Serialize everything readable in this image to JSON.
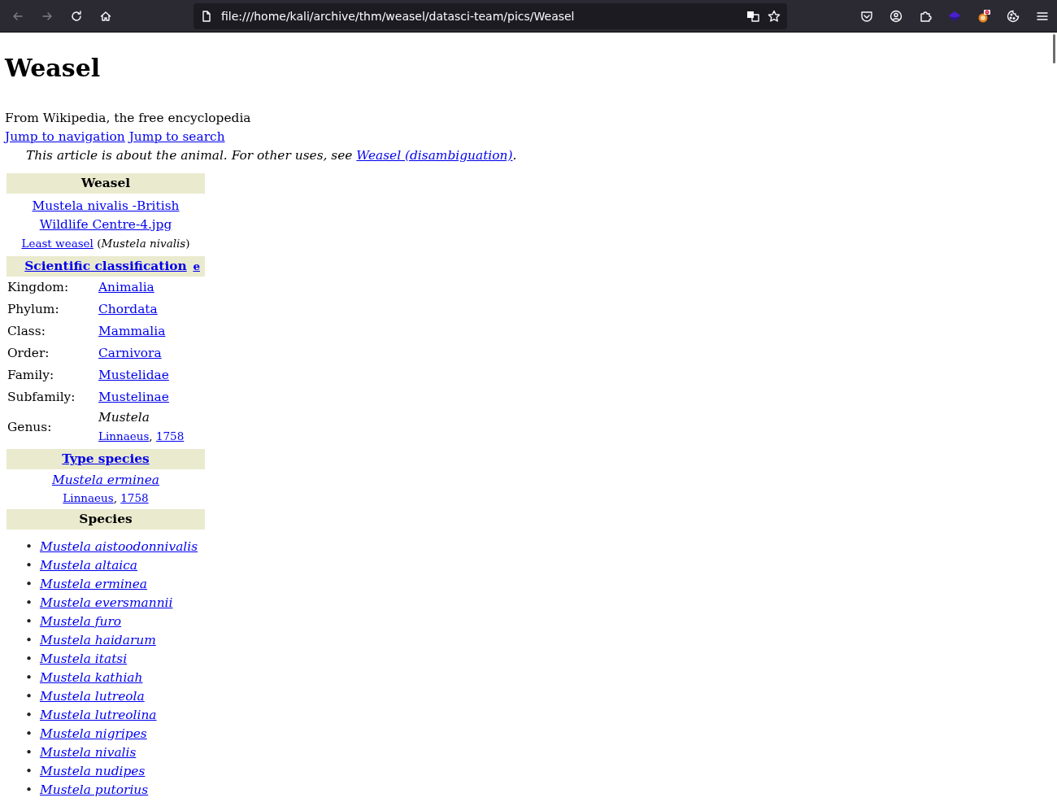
{
  "browser": {
    "url": "file:///home/kali/archive/thm/weasel/datasci-team/pics/Weasel",
    "back_disabled": true,
    "forward_disabled": true
  },
  "article": {
    "title": "Weasel",
    "tagline": "From Wikipedia, the free encyclopedia",
    "jump_links": [
      "Jump to navigation",
      "Jump to search"
    ],
    "hatnote": {
      "text": "This article is about the animal. For other uses, see ",
      "link": "Weasel (disambiguation)",
      "end": "."
    }
  },
  "infobox": {
    "title": "Weasel",
    "image_link": "Mustela nivalis -British Wildlife Centre-4.jpg",
    "caption_link": "Least weasel",
    "caption_species": "(*Mustela nivalis*)",
    "classification_heading": "Scientific classification",
    "edit_link": "e",
    "ranks": [
      {
        "rank": "Kingdom:",
        "taxon": "Animalia"
      },
      {
        "rank": "Phylum:",
        "taxon": "Chordata"
      },
      {
        "rank": "Class:",
        "taxon": "Mammalia"
      },
      {
        "rank": "Order:",
        "taxon": "Carnivora"
      },
      {
        "rank": "Family:",
        "taxon": "Mustelidae"
      },
      {
        "rank": "Subfamily:",
        "taxon": "Mustelinae"
      },
      {
        "rank": "Genus:",
        "taxon": "Mustela",
        "authority": "Linnaeus",
        "separator": ",",
        "year": "1758"
      }
    ],
    "type_species_heading": "Type species",
    "type_species": "Mustela erminea",
    "type_authority": "Linnaeus",
    "type_separator": ",",
    "type_year": "1758",
    "species_heading": "Species"
  },
  "species_bullet": "•",
  "species": [
    "Mustela aistoodonnivalis",
    "Mustela altaica",
    "Mustela erminea",
    "Mustela eversmannii",
    "Mustela furo",
    "Mustela haidarum",
    "Mustela itatsi",
    "Mustela kathiah",
    "Mustela lutreola",
    "Mustela lutreolina",
    "Mustela nigripes",
    "Mustela nivalis",
    "Mustela nudipes",
    "Mustela putorius"
  ]
}
